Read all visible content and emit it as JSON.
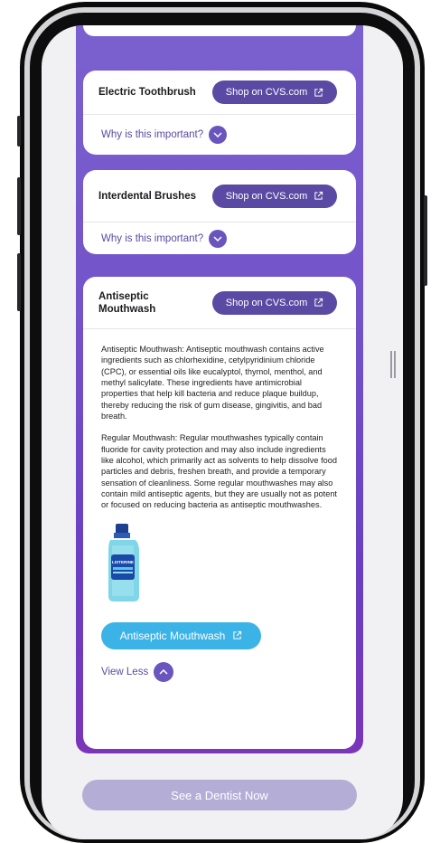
{
  "cards": [
    {
      "title": "Electric Toothbrush",
      "shop_label": "Shop on CVS.com",
      "why_label": "Why is this important?"
    },
    {
      "title": "Interdental Brushes",
      "shop_label": "Shop on CVS.com",
      "why_label": "Why is this important?"
    },
    {
      "title": "Antiseptic Mouthwash",
      "shop_label": "Shop on CVS.com",
      "paragraph1": "Antiseptic Mouthwash: Antiseptic mouthwash contains active ingredients such as chlorhexidine, cetylpyridinium chloride (CPC), or essential oils like eucalyptol, thymol, menthol, and methyl salicylate. These ingredients have antimicrobial properties that help kill bacteria and reduce plaque buildup, thereby reducing the risk of gum disease, gingivitis, and bad breath.",
      "paragraph2": "Regular Mouthwash: Regular mouthwashes typically contain fluoride for cavity protection and may also include ingredients like alcohol, which primarily act as solvents to help dissolve food particles and debris, freshen breath, and provide a temporary sensation of cleanliness. Some regular mouthwashes may also contain mild antiseptic agents, but they are usually not as potent or focused on reducing bacteria as antiseptic mouthwashes.",
      "product_label": "Antiseptic Mouthwash",
      "bottle_brand": "LISTERINE",
      "view_less_label": "View Less"
    }
  ],
  "dentist_button": "See a Dentist Now",
  "colors": {
    "panel_purple": "#7454c9",
    "shop_button": "#5b4aa4",
    "product_button": "#3bb3e6",
    "dentist_button": "#b4aed6"
  },
  "icons": [
    "external-link-icon",
    "chevron-down-icon",
    "chevron-up-icon"
  ]
}
